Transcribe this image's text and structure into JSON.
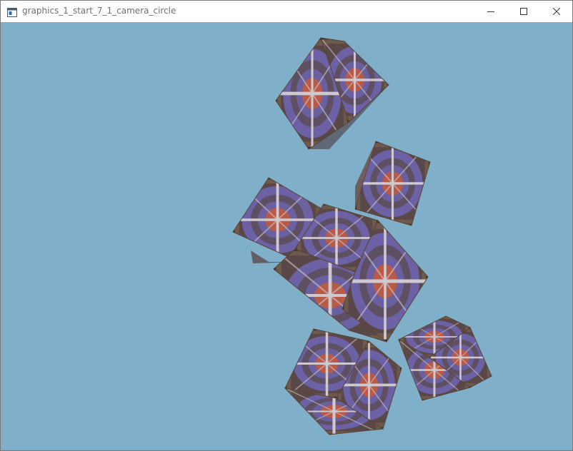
{
  "window": {
    "title": "graphics_1_start_7_1_camera_circle",
    "app_icon": "window-app-icon",
    "controls": {
      "minimize_icon": "minimize-icon",
      "maximize_icon": "maximize-icon",
      "close_icon": "close-icon"
    }
  },
  "scene": {
    "clear_color": "#7fafc9",
    "cube_count": 7,
    "texture": {
      "frame_color": "#6e5a4c",
      "fill_color": "#5a4748",
      "ring_color": "#6d64ae",
      "center_color": "#b85a45",
      "cross_color": "#cfc9cf"
    }
  }
}
